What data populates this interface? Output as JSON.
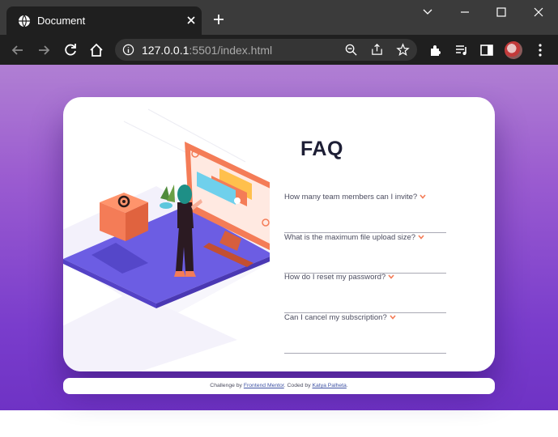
{
  "browser": {
    "tab_title": "Document",
    "url_host": "127.0.0.1",
    "url_rest": ":5501/index.html"
  },
  "page": {
    "title": "FAQ",
    "questions": [
      "How many team members can I invite?",
      "What is the maximum file upload size?",
      "How do I reset my password?",
      "Can I cancel my subscription?"
    ],
    "footer": {
      "prefix": "Challenge by ",
      "link1": "Frontend Mentor",
      "middle": ". Coded by ",
      "link2": "Katya Palheta",
      "suffix": "."
    }
  },
  "colors": {
    "accent": "#f47c57",
    "heading": "#1d1e35",
    "bg_top": "#b07fd3",
    "bg_bottom": "#6b2fc2"
  }
}
